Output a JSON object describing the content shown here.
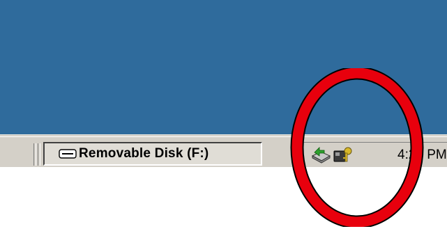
{
  "taskbar": {
    "window_button": {
      "label": "Removable Disk (F:)",
      "icon": "removable-drive-icon"
    },
    "tray": {
      "icons": [
        "safely-remove-hardware-icon",
        "security-key-icon"
      ],
      "clock": "4:29 PM"
    }
  },
  "annotation": {
    "shape": "ellipse",
    "color": "#e8000d",
    "outline": "#000000"
  },
  "colors": {
    "desktop": "#2f6b9c",
    "taskbar": "#d4d0c8"
  }
}
